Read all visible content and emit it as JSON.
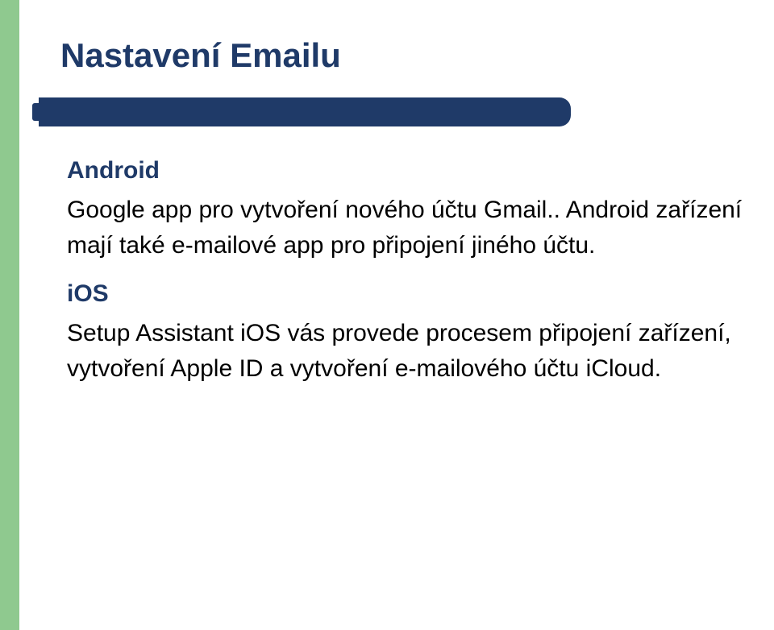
{
  "title": "Nastavení Emailu",
  "sections": {
    "android": {
      "heading": "Android",
      "text": "Google app pro vytvoření nového účtu Gmail.. Android zařízení mají také e-mailové app pro připojení jiného účtu."
    },
    "ios": {
      "heading": "iOS",
      "text": "Setup Assistant iOS vás provede procesem připojení zařízení, vytvoření Apple ID a vytvoření e-mailového účtu iCloud."
    }
  }
}
